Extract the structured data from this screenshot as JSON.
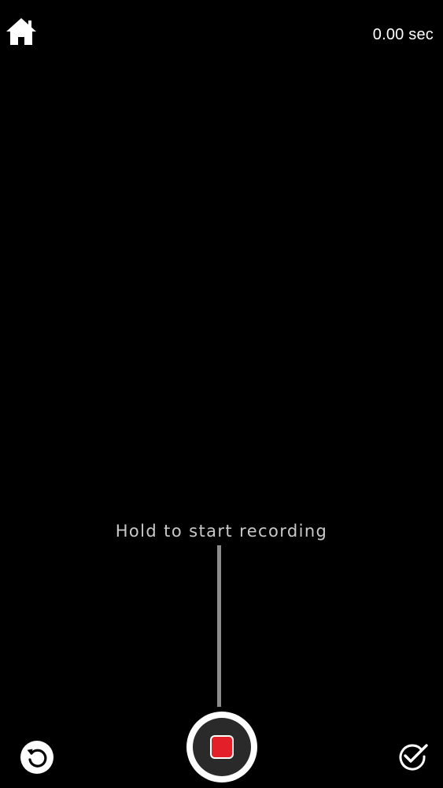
{
  "header": {
    "home_icon": "home-icon",
    "timer_text": "0.00 sec"
  },
  "hint": {
    "text": "Hold to start recording"
  },
  "controls": {
    "undo_icon": "undo-icon",
    "record_icon": "record-stop-icon",
    "done_icon": "checkmark-circle-icon"
  },
  "colors": {
    "background": "#000000",
    "record_red": "#e3202a",
    "hint_text": "#c9c9c9",
    "hint_line": "#8c8c8c"
  }
}
